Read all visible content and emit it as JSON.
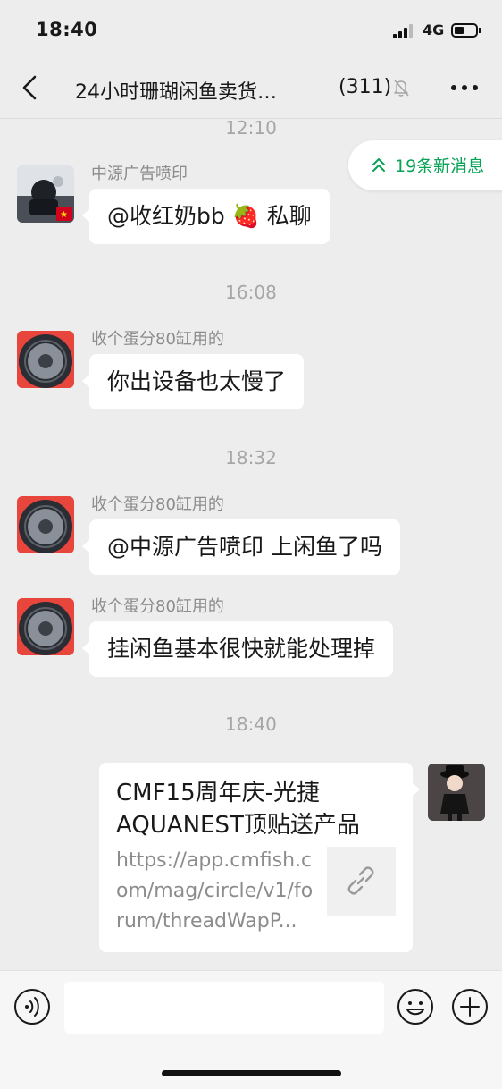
{
  "status_bar": {
    "time": "18:40",
    "network": "4G",
    "signal_bars": 3,
    "battery_level": 0.35
  },
  "header": {
    "title": "24小时珊瑚闲鱼卖货…",
    "member_count": "(311)",
    "muted": true
  },
  "new_messages": {
    "label": "19条新消息",
    "color": "#07a256"
  },
  "messages": [
    {
      "timestamp": "12:10",
      "sender": "中源广告喷印",
      "text": "@收红奶bb 🍓 私聊"
    },
    {
      "timestamp": "16:08",
      "sender": "收个蛋分80缸用的",
      "text": "你出设备也太慢了"
    },
    {
      "timestamp": "18:32",
      "sender": "收个蛋分80缸用的",
      "text": "@中源广告喷印 上闲鱼了吗"
    },
    {
      "sender": "收个蛋分80缸用的",
      "text": "挂闲鱼基本很快就能处理掉"
    }
  ],
  "own_message": {
    "timestamp": "18:40",
    "card_title": "CMF15周年庆-光捷AQUANEST顶贴送产品",
    "card_url": "https://app.cmfish.com/mag/circle/v1/forum/threadWapP..."
  },
  "input_bar": {
    "placeholder": ""
  }
}
